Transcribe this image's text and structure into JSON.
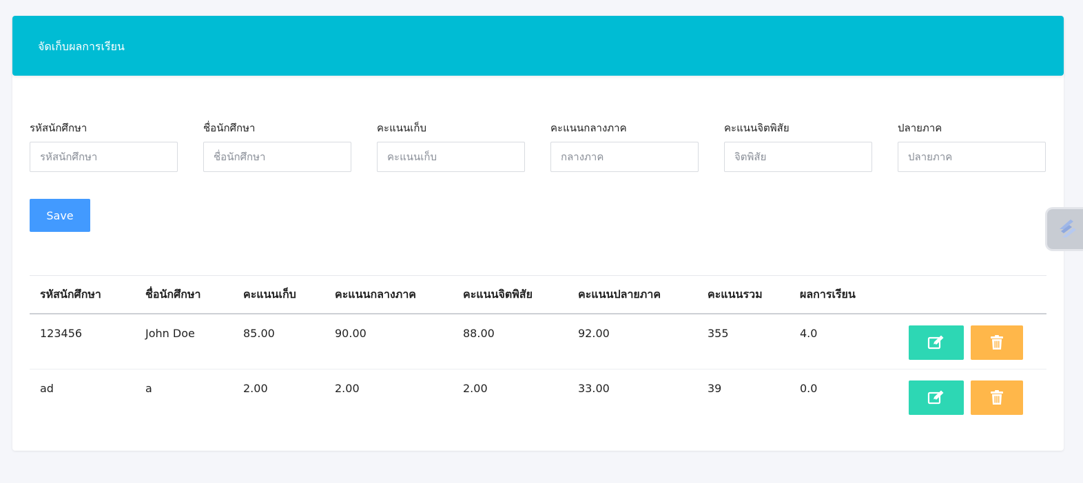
{
  "header": {
    "title": "จัดเก็บผลการเรียน"
  },
  "form": {
    "fields": [
      {
        "label": "รหัสนักศึกษา",
        "placeholder": "รหัสนักศึกษา",
        "value": ""
      },
      {
        "label": "ชื่อนักศึกษา",
        "placeholder": "ชื่อนักศึกษา",
        "value": ""
      },
      {
        "label": "คะแนนเก็บ",
        "placeholder": "คะแนนเก็บ",
        "value": ""
      },
      {
        "label": "คะแนนกลางภาค",
        "placeholder": "กลางภาค",
        "value": ""
      },
      {
        "label": "คะแนนจิตพิสัย",
        "placeholder": "จิตพิสัย",
        "value": ""
      },
      {
        "label": "ปลายภาค",
        "placeholder": "ปลายภาค",
        "value": ""
      }
    ],
    "save_label": "Save"
  },
  "table": {
    "columns": [
      "รหัสนักศึกษา",
      "ชื่อนักศึกษา",
      "คะแนนเก็บ",
      "คะแนนกลางภาค",
      "คะแนนจิตพิสัย",
      "คะแนนปลายภาค",
      "คะแนนรวม",
      "ผลการเรียน",
      ""
    ],
    "rows": [
      {
        "id": "123456",
        "name": "John Doe",
        "collected": "85.00",
        "midterm": "90.00",
        "attitude": "88.00",
        "final": "92.00",
        "total": "355",
        "grade": "4.0"
      },
      {
        "id": "ad",
        "name": "a",
        "collected": "2.00",
        "midterm": "2.00",
        "attitude": "2.00",
        "final": "33.00",
        "total": "39",
        "grade": "0.0"
      }
    ],
    "row_actions": {
      "edit_icon": "edit-icon",
      "delete_icon": "trash-icon"
    }
  },
  "colors": {
    "header_bg": "#00bcd4",
    "save_button": "#429aff",
    "edit_button": "#2dd7b4",
    "delete_button": "#ffb74a"
  },
  "side_widget": {
    "icon": "stripe-s-icon"
  }
}
